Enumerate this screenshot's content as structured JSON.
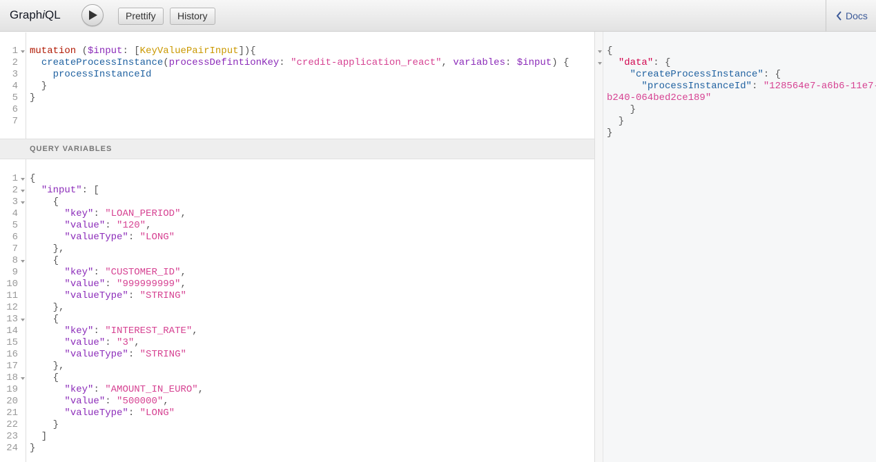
{
  "app": {
    "title_pre": "Graph",
    "title_i": "i",
    "title_post": "QL"
  },
  "toolbar": {
    "prettify_label": "Prettify",
    "history_label": "History",
    "docs_label": "Docs"
  },
  "query_editor": {
    "line_numbers": [
      "1",
      "2",
      "3",
      "4",
      "5",
      "6",
      "7"
    ],
    "line1": {
      "kw": "mutation",
      "open": " (",
      "var": "$input",
      "colon": ": ",
      "lb": "[",
      "type": "KeyValuePairInput",
      "rest": "]){"
    },
    "line2": {
      "indent": "  ",
      "field": "createProcessInstance",
      "p1": "(",
      "arg1": "processDefintionKey",
      "c1": ": ",
      "str1": "\"credit-application_react\"",
      "comma": ", ",
      "arg2": "variables",
      "c2": ": ",
      "var": "$input",
      "rest": ") {"
    },
    "line3": {
      "indent": "    ",
      "field": "processInstanceId"
    },
    "line4": "  }",
    "line5": "}"
  },
  "variables": {
    "header": "QUERY VARIABLES",
    "line_numbers": [
      "1",
      "2",
      "3",
      "4",
      "5",
      "6",
      "7",
      "8",
      "9",
      "10",
      "11",
      "12",
      "13",
      "14",
      "15",
      "16",
      "17",
      "18",
      "19",
      "20",
      "21",
      "22",
      "23",
      "24"
    ],
    "input_key": "\"input\"",
    "pairs": [
      {
        "key": "\"LOAN_PERIOD\"",
        "value": "\"120\"",
        "valueType": "\"LONG\""
      },
      {
        "key": "\"CUSTOMER_ID\"",
        "value": "\"999999999\"",
        "valueType": "\"STRING\""
      },
      {
        "key": "\"INTEREST_RATE\"",
        "value": "\"3\"",
        "valueType": "\"STRING\""
      },
      {
        "key": "\"AMOUNT_IN_EURO\"",
        "value": "\"500000\"",
        "valueType": "\"LONG\""
      }
    ],
    "labels": {
      "key": "\"key\"",
      "value": "\"value\"",
      "valueType": "\"valueType\""
    }
  },
  "result": {
    "data_key": "\"data\"",
    "create_key": "\"createProcessInstance\"",
    "pid_key": "\"processInstanceId\"",
    "pid_value_part1": "\"128564e7-a6b6-11e7-",
    "pid_value_part2": "b240-064bed2ce189\""
  }
}
